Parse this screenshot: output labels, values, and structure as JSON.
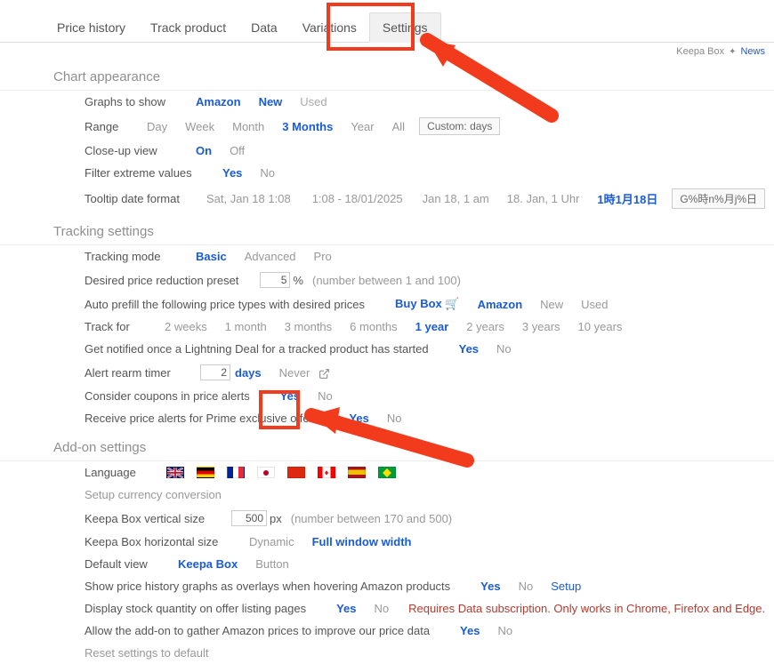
{
  "tabs": {
    "price_history": "Price history",
    "track_product": "Track product",
    "data": "Data",
    "variations": "Variations",
    "settings": "Settings"
  },
  "topright": {
    "keepa_box": "Keepa Box",
    "news": "News"
  },
  "sections": {
    "chart_appearance": "Chart appearance",
    "tracking_settings": "Tracking settings",
    "addon_settings": "Add-on settings"
  },
  "chart": {
    "graphs_label": "Graphs to show",
    "amazon": "Amazon",
    "new": "New",
    "used": "Used",
    "range_label": "Range",
    "day": "Day",
    "week": "Week",
    "month": "Month",
    "m3": "3 Months",
    "year": "Year",
    "all": "All",
    "custom": "Custom: days",
    "closeup_label": "Close-up view",
    "on": "On",
    "off": "Off",
    "filter_label": "Filter extreme values",
    "yes": "Yes",
    "no": "No",
    "tooltip_label": "Tooltip date format",
    "d1": "Sat, Jan 18 1:08",
    "d2": "1:08 - 18/01/2025",
    "d3": "Jan 18, 1 am",
    "d4": "18. Jan, 1 Uhr",
    "d5": "1時1月18日",
    "d6": "G%時n%月j%日"
  },
  "tracking": {
    "mode_label": "Tracking mode",
    "basic": "Basic",
    "advanced": "Advanced",
    "pro": "Pro",
    "desired_label": "Desired price reduction preset",
    "desired_val": "5",
    "pct": "%",
    "desired_hint": "(number between 1 and 100)",
    "prefill_label": "Auto prefill the following price types with desired prices",
    "buybox": "Buy Box",
    "amazon": "Amazon",
    "new": "New",
    "used": "Used",
    "trackfor_label": "Track for",
    "w2": "2 weeks",
    "m1": "1 month",
    "m3": "3 months",
    "m6": "6 months",
    "y1": "1 year",
    "y2": "2 years",
    "y3": "3 years",
    "y10": "10 years",
    "lightning_label": "Get notified once a Lightning Deal for a tracked product has started",
    "yes": "Yes",
    "no": "No",
    "rearm_label": "Alert rearm timer",
    "rearm_val": "2",
    "days": "days",
    "never": "Never",
    "coupons_label": "Consider coupons in price alerts",
    "prime_label": "Receive price alerts for Prime exclusive offers"
  },
  "addon": {
    "language_label": "Language",
    "currency_label": "Setup currency conversion",
    "vsize_label": "Keepa Box vertical size",
    "vsize_val": "500",
    "px": "px",
    "vsize_hint": "(number between 170 and 500)",
    "hsize_label": "Keepa Box horizontal size",
    "dynamic": "Dynamic",
    "fullwidth": "Full window width",
    "defaultview_label": "Default view",
    "keepabox": "Keepa Box",
    "button": "Button",
    "overlay_label": "Show price history graphs as overlays when hovering Amazon products",
    "yes": "Yes",
    "no": "No",
    "setup": "Setup",
    "stock_label": "Display stock quantity on offer listing pages",
    "stock_warn": "Requires Data subscription. Only works in Chrome, Firefox and Edge.",
    "gather_label": "Allow the add-on to gather Amazon prices to improve our price data",
    "reset_label": "Reset settings to default"
  }
}
